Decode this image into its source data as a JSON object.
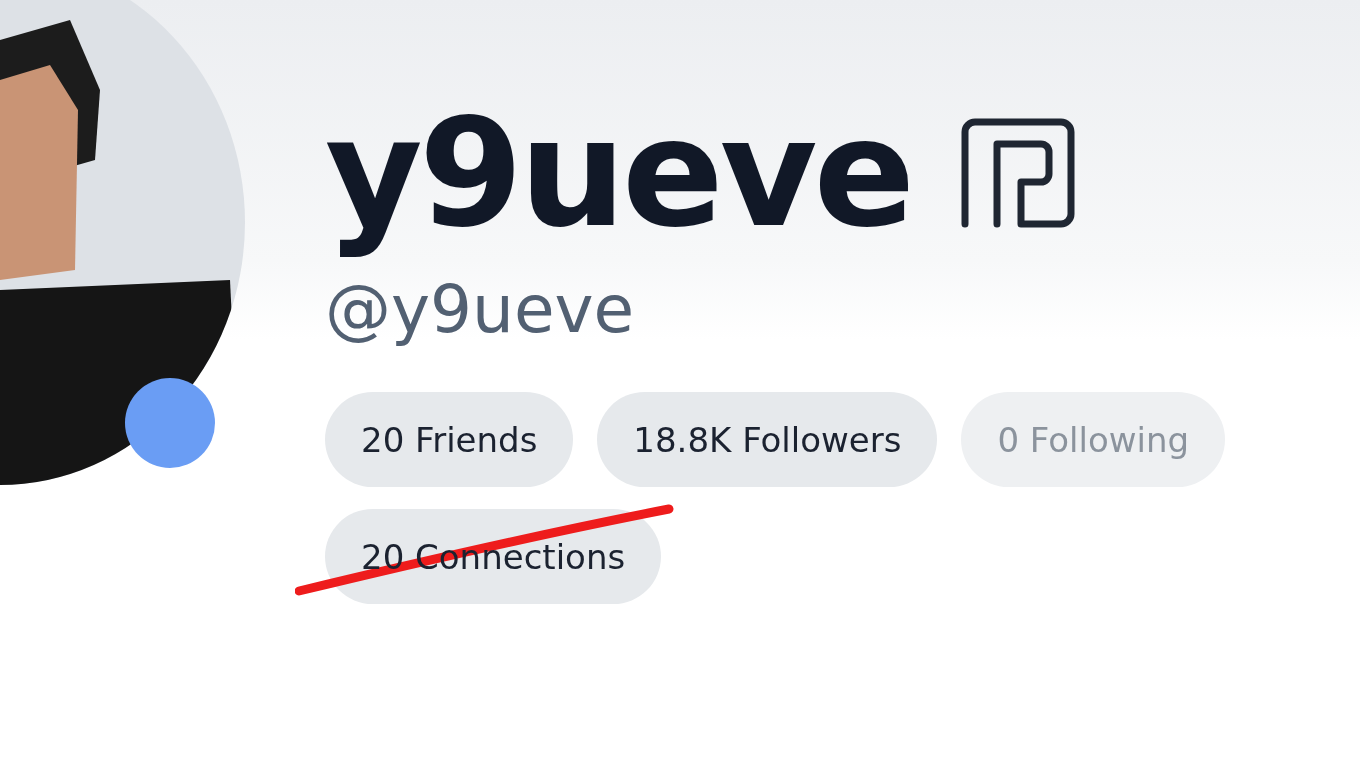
{
  "profile": {
    "display_name": "y9ueve",
    "handle": "@y9ueve",
    "online": true
  },
  "stats": [
    {
      "label": "20 Friends",
      "disabled": false
    },
    {
      "label": "18.8K Followers",
      "disabled": false
    },
    {
      "label": "0 Following",
      "disabled": true
    }
  ],
  "connections": {
    "label": "20 Connections",
    "struck": true
  }
}
